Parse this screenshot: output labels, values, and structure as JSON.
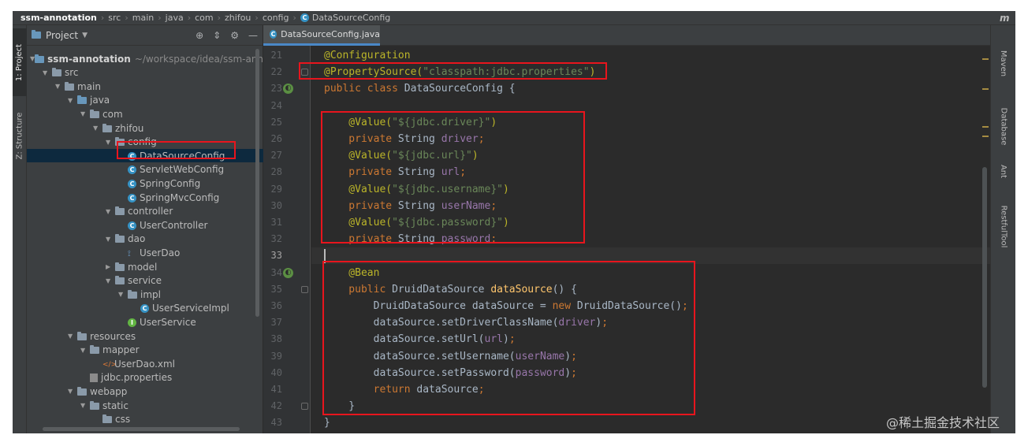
{
  "breadcrumb": {
    "items": [
      "ssm-annotation",
      "src",
      "main",
      "java",
      "com",
      "zhifou",
      "config"
    ],
    "current_file": "DataSourceConfig"
  },
  "left_toolbar": {
    "project_tab": "1: Project",
    "structure_tab": "Z: Structure"
  },
  "project_panel": {
    "title": "Project",
    "dropdown_icon": "chevron-down-icon",
    "buttons": [
      "locate-icon",
      "collapse-icon",
      "gear-icon",
      "minimize-icon"
    ],
    "tree": [
      {
        "label": "ssm-annotation",
        "path": "~/workspace/idea/ssm-anno",
        "type": "module",
        "expanded": true
      },
      {
        "label": "src",
        "type": "folder",
        "expanded": true
      },
      {
        "label": "main",
        "type": "folder",
        "expanded": true
      },
      {
        "label": "java",
        "type": "source-folder",
        "expanded": true
      },
      {
        "label": "com",
        "type": "package",
        "expanded": true
      },
      {
        "label": "zhifou",
        "type": "package",
        "expanded": true
      },
      {
        "label": "config",
        "type": "package",
        "expanded": true
      },
      {
        "label": "DataSourceConfig",
        "type": "class",
        "selected": true
      },
      {
        "label": "ServletWebConfig",
        "type": "class"
      },
      {
        "label": "SpringConfig",
        "type": "class"
      },
      {
        "label": "SpringMvcConfig",
        "type": "class"
      },
      {
        "label": "controller",
        "type": "package",
        "expanded": true
      },
      {
        "label": "UserController",
        "type": "class"
      },
      {
        "label": "dao",
        "type": "package",
        "expanded": true
      },
      {
        "label": "UserDao",
        "type": "dao"
      },
      {
        "label": "model",
        "type": "package",
        "expanded": false
      },
      {
        "label": "service",
        "type": "package",
        "expanded": true
      },
      {
        "label": "impl",
        "type": "package",
        "expanded": true
      },
      {
        "label": "UserServiceImpl",
        "type": "class"
      },
      {
        "label": "UserService",
        "type": "interface"
      },
      {
        "label": "resources",
        "type": "folder",
        "expanded": true
      },
      {
        "label": "mapper",
        "type": "folder",
        "expanded": true
      },
      {
        "label": "UserDao.xml",
        "type": "xml"
      },
      {
        "label": "jdbc.properties",
        "type": "properties"
      },
      {
        "label": "webapp",
        "type": "folder",
        "expanded": true
      },
      {
        "label": "static",
        "type": "folder",
        "expanded": true
      },
      {
        "label": "css",
        "type": "folder"
      }
    ]
  },
  "editor": {
    "tab_label": "DataSourceConfig.java",
    "line_numbers": [
      "21",
      "22",
      "23",
      "24",
      "25",
      "26",
      "27",
      "28",
      "29",
      "30",
      "31",
      "32",
      "33",
      "34",
      "35",
      "36",
      "37",
      "38",
      "39",
      "40",
      "41",
      "42",
      "43"
    ],
    "current_line": "33",
    "code": [
      [
        {
          "t": "@Configuration",
          "c": "an"
        }
      ],
      [
        {
          "t": "@PropertySource(",
          "c": "an"
        },
        {
          "t": "\"classpath:jdbc.properties\"",
          "c": "str"
        },
        {
          "t": ")",
          "c": "an"
        }
      ],
      [
        {
          "t": "public class ",
          "c": "kw"
        },
        {
          "t": "DataSourceConfig {",
          "c": ""
        }
      ],
      [],
      [
        {
          "t": "    @Value(",
          "c": "an"
        },
        {
          "t": "\"${jdbc.driver}\"",
          "c": "str"
        },
        {
          "t": ")",
          "c": "an"
        }
      ],
      [
        {
          "t": "    private ",
          "c": "kw"
        },
        {
          "t": "String ",
          "c": ""
        },
        {
          "t": "driver",
          "c": "fld"
        },
        {
          "t": ";",
          "c": "kw"
        }
      ],
      [
        {
          "t": "    @Value(",
          "c": "an"
        },
        {
          "t": "\"${jdbc.url}\"",
          "c": "str"
        },
        {
          "t": ")",
          "c": "an"
        }
      ],
      [
        {
          "t": "    private ",
          "c": "kw"
        },
        {
          "t": "String ",
          "c": ""
        },
        {
          "t": "url",
          "c": "fld"
        },
        {
          "t": ";",
          "c": "kw"
        }
      ],
      [
        {
          "t": "    @Value(",
          "c": "an"
        },
        {
          "t": "\"${jdbc.username}\"",
          "c": "str"
        },
        {
          "t": ")",
          "c": "an"
        }
      ],
      [
        {
          "t": "    private ",
          "c": "kw"
        },
        {
          "t": "String ",
          "c": ""
        },
        {
          "t": "userName",
          "c": "fld"
        },
        {
          "t": ";",
          "c": "kw"
        }
      ],
      [
        {
          "t": "    @Value(",
          "c": "an"
        },
        {
          "t": "\"${jdbc.password}\"",
          "c": "str"
        },
        {
          "t": ")",
          "c": "an"
        }
      ],
      [
        {
          "t": "    private ",
          "c": "kw"
        },
        {
          "t": "String ",
          "c": ""
        },
        {
          "t": "password",
          "c": "fld"
        },
        {
          "t": ";",
          "c": "kw"
        }
      ],
      [],
      [
        {
          "t": "    @Bean",
          "c": "an"
        }
      ],
      [
        {
          "t": "    public ",
          "c": "kw"
        },
        {
          "t": "DruidDataSource ",
          "c": ""
        },
        {
          "t": "dataSource",
          "c": "mth"
        },
        {
          "t": "() {",
          "c": ""
        }
      ],
      [
        {
          "t": "        DruidDataSource dataSource = ",
          "c": ""
        },
        {
          "t": "new ",
          "c": "kw"
        },
        {
          "t": "DruidDataSource()",
          "c": ""
        },
        {
          "t": ";",
          "c": "kw"
        }
      ],
      [
        {
          "t": "        dataSource.setDriverClassName(",
          "c": ""
        },
        {
          "t": "driver",
          "c": "fld"
        },
        {
          "t": ")",
          "c": ""
        },
        {
          "t": ";",
          "c": "kw"
        }
      ],
      [
        {
          "t": "        dataSource.setUrl(",
          "c": ""
        },
        {
          "t": "url",
          "c": "fld"
        },
        {
          "t": ")",
          "c": ""
        },
        {
          "t": ";",
          "c": "kw"
        }
      ],
      [
        {
          "t": "        dataSource.setUsername(",
          "c": ""
        },
        {
          "t": "userName",
          "c": "fld"
        },
        {
          "t": ")",
          "c": ""
        },
        {
          "t": ";",
          "c": "kw"
        }
      ],
      [
        {
          "t": "        dataSource.setPassword(",
          "c": ""
        },
        {
          "t": "password",
          "c": "fld"
        },
        {
          "t": ")",
          "c": ""
        },
        {
          "t": ";",
          "c": "kw"
        }
      ],
      [
        {
          "t": "        return ",
          "c": "kw"
        },
        {
          "t": "dataSource",
          "c": ""
        },
        {
          "t": ";",
          "c": "kw"
        }
      ],
      [
        {
          "t": "    }",
          "c": ""
        }
      ],
      [
        {
          "t": "}",
          "c": ""
        }
      ]
    ]
  },
  "right_toolbar": {
    "logo": "m",
    "tabs": [
      "Maven",
      "Database",
      "Ant",
      "RestfulTool"
    ]
  },
  "watermark": "@稀土掘金技术社区",
  "colors": {
    "background": "#2b2b2b",
    "annotation": "#bbb529",
    "keyword": "#cc7832",
    "string": "#6a8759",
    "field": "#9876aa",
    "method": "#ffc66d",
    "highlight_box": "#e8151d",
    "selection": "#0d293e"
  }
}
